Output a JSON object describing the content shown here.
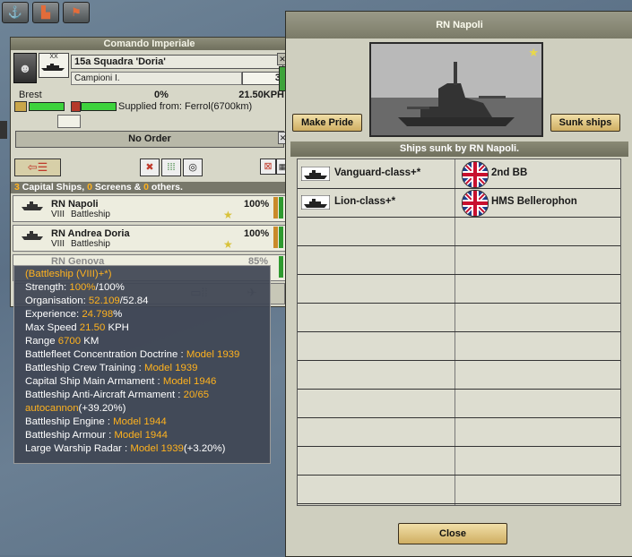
{
  "colors": {
    "accent_yellow": "#ffb21e",
    "green_bar": "#3dd23c",
    "button_gold": "#d8b86c",
    "header_olive": "#7d7d6a"
  },
  "topbar": {
    "icons": [
      "ship-icon",
      "factory-icon",
      "flag-icon"
    ]
  },
  "command": {
    "title": "Comando Imperiale",
    "unit_name": "15a Squadra 'Doria'",
    "rank": "XX",
    "leader": "Campioni  I.",
    "ship_count": "3",
    "location": "Brest",
    "percent": "0%",
    "speed": "21.50KPH",
    "supplied": "Supplied from: Ferrol(6700km)",
    "order": "No Order",
    "summary": {
      "capital": "3",
      "capital_label": " Capital Ships, ",
      "screens": "0",
      "screens_label": " Screens & ",
      "others": "0",
      "others_label": " others."
    },
    "supply_level": 1.0,
    "fuel_level": 1.0
  },
  "ships": [
    {
      "name": "RN Napoli",
      "tier": "VIII",
      "type": "Battleship",
      "strength": "100%"
    },
    {
      "name": "RN Andrea Doria",
      "tier": "VIII",
      "type": "Battleship",
      "strength": "100%"
    },
    {
      "name": "RN Genova",
      "strength": "85%"
    }
  ],
  "tooltip": {
    "header": "(Battleship (VIII)+*)",
    "strength_label": "Strength: ",
    "strength_val": "100%",
    "strength_max": "/100%",
    "org_label": "Organisation: ",
    "org_val": "52.109",
    "org_max": "/52.84",
    "exp_label": "Experience: ",
    "exp_val": "24.798",
    "exp_unit": "%",
    "speed_label": "Max Speed ",
    "speed_val": "21.50",
    "speed_unit": " KPH",
    "range_label": "Range ",
    "range_val": "6700",
    "range_unit": " KM",
    "techs": [
      {
        "label": "Battlefleet Concentration Doctrine : ",
        "val": "Model 1939",
        "extra": ""
      },
      {
        "label": "Battleship Crew Training : ",
        "val": "Model 1939",
        "extra": ""
      },
      {
        "label": "Capital Ship Main Armament : ",
        "val": "Model 1946",
        "extra": ""
      },
      {
        "label": "Battleship Anti-Aircraft Armament : ",
        "val": "20/65",
        "extra": ""
      },
      {
        "label": "",
        "val": "autocannon",
        "extra": "(+39.20%)"
      },
      {
        "label": "Battleship Engine : ",
        "val": "Model 1944",
        "extra": ""
      },
      {
        "label": "Battleship Armour : ",
        "val": "Model 1944",
        "extra": ""
      },
      {
        "label": "Large Warship Radar : ",
        "val": "Model 1939",
        "extra": "(+3.20%)"
      }
    ]
  },
  "window": {
    "title": "RN Napoli",
    "make_pride": "Make Pride",
    "sunk_ships": "Sunk ships",
    "sunk_header": "Ships sunk by RN Napoli.",
    "sunk": [
      {
        "class": "Vanguard-class+*",
        "ship": "2nd BB",
        "flag": "uk-flag-icon"
      },
      {
        "class": "Lion-class+*",
        "ship": "HMS Bellerophon",
        "flag": "uk-flag-icon"
      }
    ],
    "close": "Close"
  }
}
